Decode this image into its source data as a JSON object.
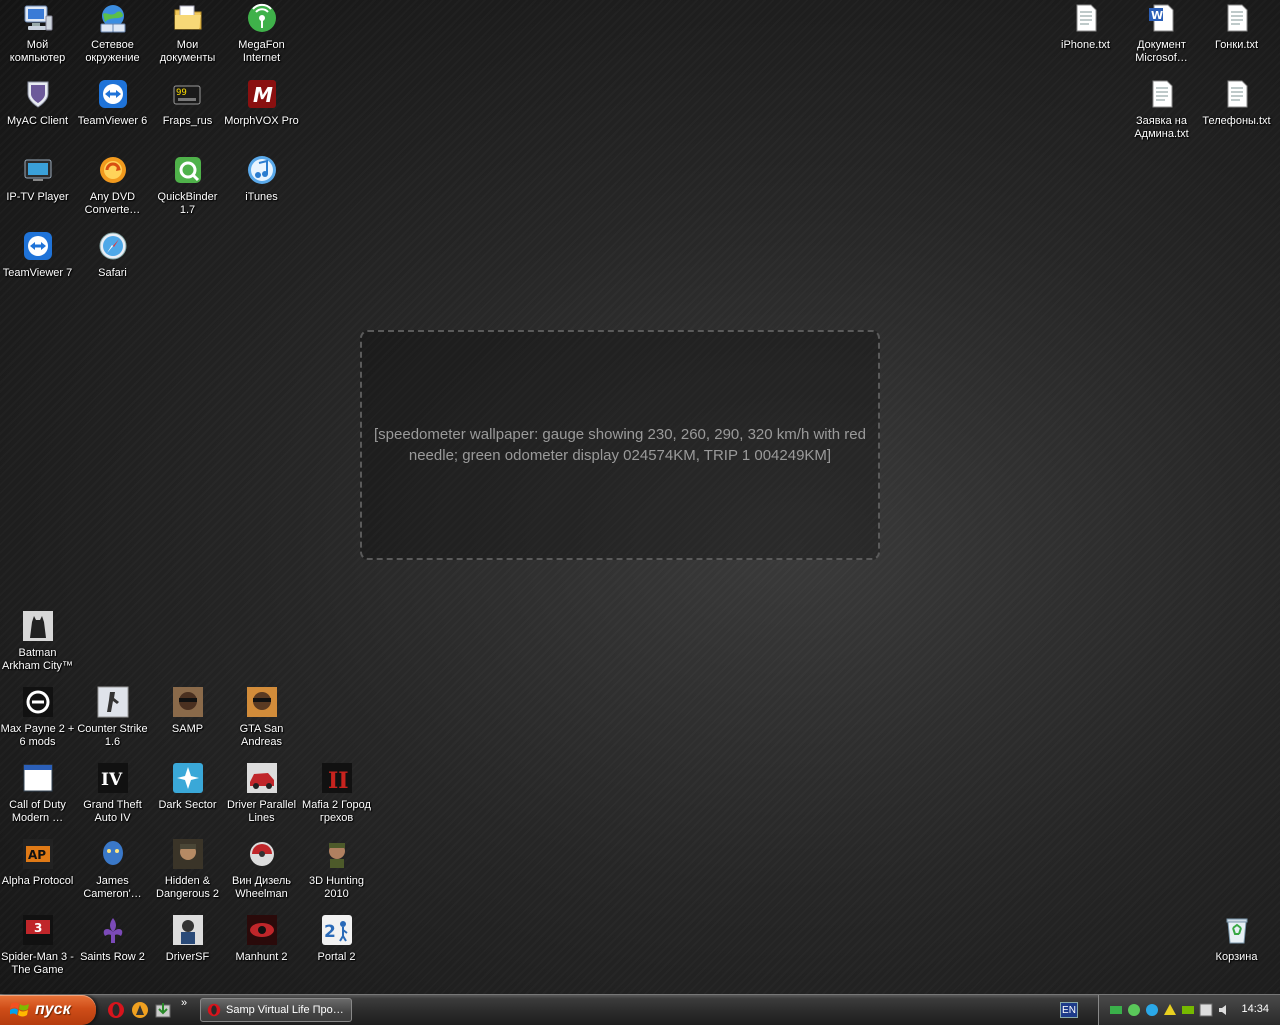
{
  "wallpaper": {
    "placeholder": "[speedometer wallpaper: gauge showing 230, 260, 290, 320 km/h with red needle; green odometer display 024574KM, TRIP 1 004249KM]"
  },
  "icons": {
    "my_computer": "Мой компьютер",
    "network": "Сетевое окружение",
    "my_documents": "Мои документы",
    "megafon": "MegaFon Internet",
    "myac": "MyAC Client",
    "teamviewer6": "TeamViewer 6",
    "fraps": "Fraps_rus",
    "morphvox": "MorphVOX Pro",
    "iptv": "IP-TV Player",
    "anydvd": "Any DVD Converte…",
    "quickbinder": "QuickBinder 1.7",
    "itunes": "iTunes",
    "teamviewer7": "TeamViewer 7",
    "safari": "Safari",
    "iphone_txt": "iPhone.txt",
    "document_ms": "Документ Microsof…",
    "gonki_txt": "Гонки.txt",
    "zayavka_txt": "Заявка на Админа.txt",
    "telefony_txt": "Телефоны.txt",
    "batman": "Batman Arkham City™",
    "maxpayne": "Max Payne 2 + 6 mods",
    "counterstrike": "Counter Strike 1.6",
    "samp": "SAMP",
    "gta_sa": "GTA San Andreas",
    "cod": "Call of Duty Modern …",
    "gta4": "Grand Theft Auto IV",
    "darksector": "Dark Sector",
    "driver_pl": "Driver Parallel Lines",
    "mafia2": "Mafia 2 Город грехов",
    "alpha": "Alpha Protocol",
    "avatar": "James Cameron'…",
    "hidden": "Hidden & Dangerous 2",
    "wheelman": "Вин Дизель Wheelman",
    "hunting": "3D Hunting 2010",
    "spiderman": "Spider-Man 3 - The Game",
    "saintsrow": "Saints Row 2",
    "driversf": "DriverSF",
    "manhunt": "Manhunt 2",
    "portal2": "Portal 2",
    "recycle": "Корзина"
  },
  "taskbar": {
    "start_label": "пуск",
    "quicklaunch_more": "»",
    "active_window": "Samp Virtual Life Про…",
    "language": "EN",
    "clock": "14:34"
  }
}
